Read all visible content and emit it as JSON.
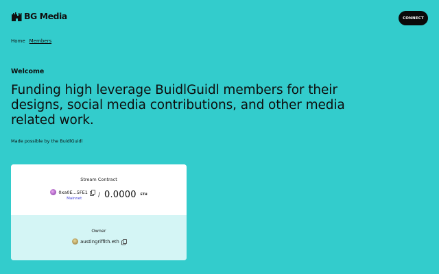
{
  "brand": {
    "name": "BG Media"
  },
  "header": {
    "connect_label": "CONNECT"
  },
  "breadcrumb": {
    "home": "Home",
    "current": "Members"
  },
  "welcome": "Welcome",
  "headline": "Funding high leverage BuidlGuidl members for their designs, social media contributions, and other media related work.",
  "made_by": "Made possible by the BuidlGuidl",
  "card": {
    "stream_label": "Stream Contract",
    "contract_address": "0xa0E...5FE1",
    "network": "Mainnet",
    "balance": "0.0000",
    "unit": "ETH",
    "owner_label": "Owner",
    "owner_ens": "austingriffith.eth"
  },
  "colors": {
    "background": "#33cccc",
    "button": "#0a0a0a",
    "card_bottom": "#d4f5f5",
    "network_link": "#3b3bd6"
  }
}
